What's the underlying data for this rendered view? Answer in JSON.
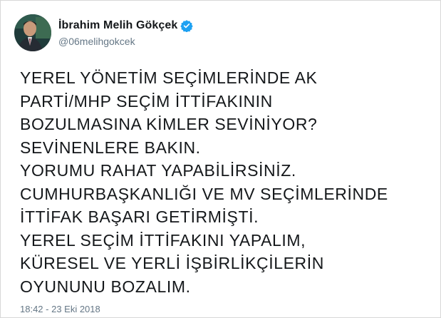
{
  "author": {
    "display_name": "İbrahim Melih Gökçek",
    "handle": "@06melihgokcek",
    "verified_icon": "verified-badge-icon",
    "verified_color": "#1da1f2"
  },
  "tweet": {
    "lines": [
      "YEREL YÖNETİM SEÇİMLERİNDE AK",
      "PARTİ/MHP SEÇİM İTTİFAKININ",
      "BOZULMASINA KİMLER SEVİNİYOR?",
      "SEVİNENLERE BAKIN.",
      "YORUMU RAHAT YAPABİLİRSİNİZ.",
      "CUMHURBAŞKANLIĞI VE MV SEÇİMLERİNDE",
      "İTTİFAK BAŞARI GETİRMİŞTİ.",
      "YEREL SEÇİM İTTİFAKINI YAPALIM,",
      "KÜRESEL VE YERLİ İŞBİRLİKÇİLERİN",
      "OYUNUNU BOZALIM."
    ],
    "timestamp": "18:42 - 23 Eki 2018"
  }
}
